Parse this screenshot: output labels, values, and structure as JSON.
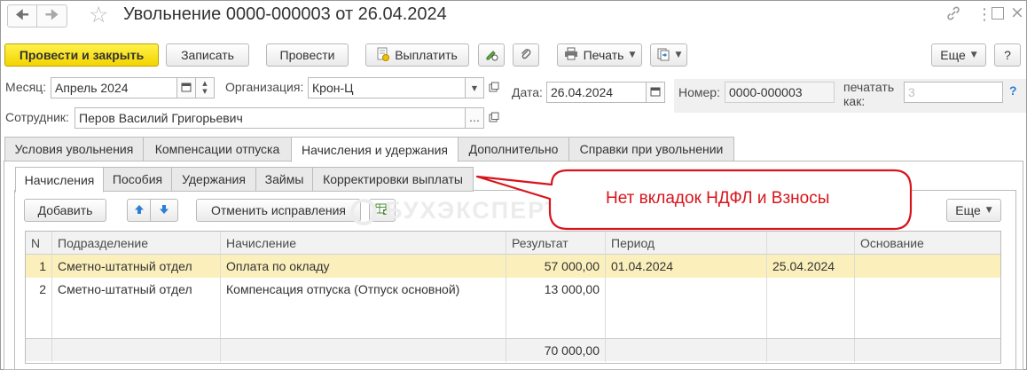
{
  "document": {
    "title": "Увольнение 0000-000003 от 26.04.2024"
  },
  "icons": {
    "back": "arrow-left-icon",
    "forward": "arrow-right-icon",
    "favorite": "star-icon",
    "link": "link-icon",
    "menu": "more-vertical-icon",
    "maximize": "maximize-icon",
    "close": "close-icon"
  },
  "toolbar": {
    "post_close_label": "Провести и закрыть",
    "save_label": "Записать",
    "post_label": "Провести",
    "pay_label": "Выплатить",
    "print_label": "Печать",
    "more_label": "Еще",
    "help_label": "?"
  },
  "form": {
    "month_label": "Месяц:",
    "month_value": "Апрель 2024",
    "org_label": "Организация:",
    "org_value": "Крон-Ц",
    "date_label": "Дата:",
    "date_value": "26.04.2024",
    "number_label": "Номер:",
    "number_value": "0000-000003",
    "print_as_label_1": "печатать",
    "print_as_label_2": "как:",
    "print_as_value": "3",
    "print_as_help": "?",
    "employee_label": "Сотрудник:",
    "employee_value": "Перов Василий Григорьевич"
  },
  "tabs": [
    {
      "label": "Условия увольнения"
    },
    {
      "label": "Компенсации отпуска"
    },
    {
      "label": "Начисления и удержания",
      "active": true
    },
    {
      "label": "Дополнительно"
    },
    {
      "label": "Справки при увольнении"
    }
  ],
  "subtabs": [
    {
      "label": "Начисления",
      "active": true
    },
    {
      "label": "Пособия"
    },
    {
      "label": "Удержания"
    },
    {
      "label": "Займы"
    },
    {
      "label": "Корректировки выплаты"
    }
  ],
  "subtoolbar": {
    "add_label": "Добавить",
    "undo_corrections_label": "Отменить исправления",
    "more_label": "Еще"
  },
  "watermark": {
    "text": "БУХЭКСПЕРТ"
  },
  "grid": {
    "columns": [
      "N",
      "Подразделение",
      "Начисление",
      "Результат",
      "Период",
      "",
      "Основание"
    ],
    "rows": [
      {
        "n": "1",
        "department": "Сметно-штатный отдел",
        "accrual": "Оплата по окладу",
        "result": "57 000,00",
        "period_from": "01.04.2024",
        "period_to": "25.04.2024",
        "basis": ""
      },
      {
        "n": "2",
        "department": "Сметно-штатный отдел",
        "accrual": "Компенсация отпуска (Отпуск основной)",
        "result": "13 000,00",
        "period_from": "",
        "period_to": "",
        "basis": ""
      }
    ],
    "total_result": "70 000,00"
  },
  "callout": {
    "text": "Нет вкладок НДФЛ и Взносы",
    "color": "#d8141b"
  },
  "colors": {
    "primary_button": "#f3d400",
    "selected_row": "#fbf0bc",
    "arrow_blue": "#2d7fd6"
  }
}
